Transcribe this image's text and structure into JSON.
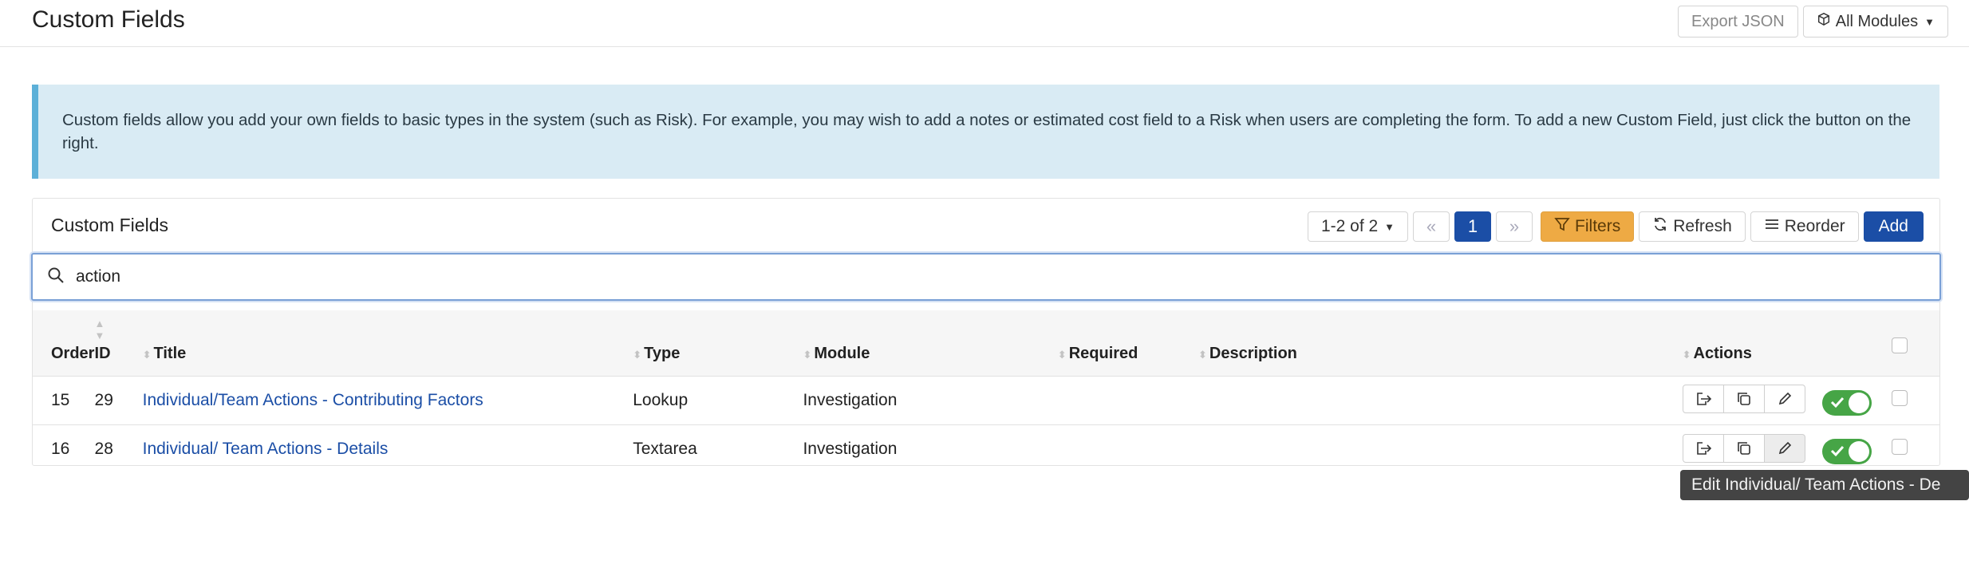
{
  "header": {
    "title": "Custom Fields",
    "export_label": "Export JSON",
    "modules_label": "All Modules"
  },
  "info_text": "Custom fields allow you add your own fields to basic types in the system (such as Risk). For example, you may wish to add a notes or estimated cost field to a Risk when users are completing the form. To add a new Custom Field, just click the button on the right.",
  "panel": {
    "title": "Custom Fields",
    "range_label": "1-2 of 2",
    "prev_label": "«",
    "current_page": "1",
    "next_label": "»",
    "filters_label": "Filters",
    "refresh_label": "Refresh",
    "reorder_label": "Reorder",
    "add_label": "Add"
  },
  "search": {
    "value": "action"
  },
  "table": {
    "columns": {
      "order": "Order",
      "id": "ID",
      "title": "Title",
      "type": "Type",
      "module": "Module",
      "required": "Required",
      "description": "Description",
      "actions": "Actions"
    },
    "rows": [
      {
        "order": "15",
        "id": "29",
        "title": "Individual/Team Actions - Contributing Factors",
        "type": "Lookup",
        "module": "Investigation",
        "required": "",
        "description": "",
        "enabled": true
      },
      {
        "order": "16",
        "id": "28",
        "title": "Individual/ Team Actions - Details",
        "type": "Textarea",
        "module": "Investigation",
        "required": "",
        "description": "",
        "enabled": true
      }
    ]
  },
  "tooltip": "Edit Individual/ Team Actions - De",
  "colors": {
    "primary": "#1b4ea6",
    "filters": "#eeaa44",
    "toggle_on": "#46a546",
    "info_bg": "#d9ebf4",
    "info_border": "#5cb0d8"
  }
}
